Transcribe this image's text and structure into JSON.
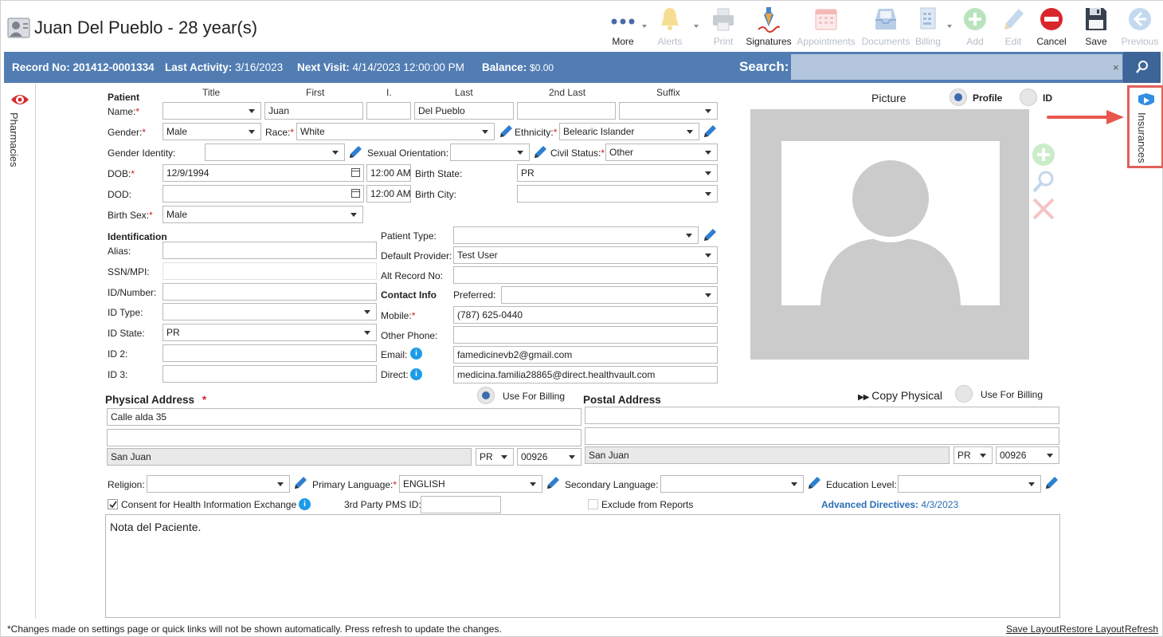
{
  "header": {
    "title": "Juan Del Pueblo - 28 year(s)"
  },
  "toolbar": [
    {
      "name": "more-button",
      "icon": "more-dots-icon",
      "label": "More",
      "enabled": true
    },
    {
      "name": "alerts-button",
      "icon": "bell-icon",
      "label": "Alerts",
      "enabled": false
    },
    {
      "name": "print-button",
      "icon": "printer-icon",
      "label": "Print",
      "enabled": false
    },
    {
      "name": "signatures-button",
      "icon": "pen-signature-icon",
      "label": "Signatures",
      "enabled": true
    },
    {
      "name": "appointments-button",
      "icon": "calendar-icon",
      "label": "Appointments",
      "enabled": false
    },
    {
      "name": "documents-button",
      "icon": "inbox-tray-icon",
      "label": "Documents",
      "enabled": false
    },
    {
      "name": "billing-button",
      "icon": "billing-icon",
      "label": "Billing",
      "enabled": false
    },
    {
      "name": "add-button",
      "icon": "plus-circle-icon",
      "label": "Add",
      "enabled": false
    },
    {
      "name": "edit-button",
      "icon": "pencil-icon",
      "label": "Edit",
      "enabled": false
    },
    {
      "name": "cancel-button",
      "icon": "cancel-circle-icon",
      "label": "Cancel",
      "enabled": true
    },
    {
      "name": "save-button",
      "icon": "floppy-disk-icon",
      "label": "Save",
      "enabled": true
    },
    {
      "name": "previous-button",
      "icon": "back-arrow-icon",
      "label": "Previous",
      "enabled": false
    }
  ],
  "bar": {
    "record_label": "Record No:",
    "record_value": "201412-0001334",
    "activity_label": "Last Activity:",
    "activity_value": "3/16/2023",
    "visit_label": "Next Visit:",
    "visit_value": "4/14/2023 12:00:00 PM",
    "balance_label": "Balance:",
    "balance_value": "$0.00",
    "search_label": "Search:",
    "search_value": "",
    "clear": "×"
  },
  "side": {
    "left_tab": "Pharmacies",
    "right_tab": "Insurances"
  },
  "patient": {
    "section": "Patient",
    "col_title": "Title",
    "col_first": "First",
    "col_initial": "I.",
    "col_last": "Last",
    "col_2ndlast": "2nd Last",
    "col_suffix": "Suffix",
    "name_label": "Name:",
    "title": "",
    "first": "Juan",
    "initial": "",
    "last": "Del Pueblo",
    "second_last": "",
    "suffix": "",
    "gender_label": "Gender:",
    "gender": "Male",
    "race_label": "Race:",
    "race": "White",
    "ethnicity_label": "Ethnicity:",
    "ethnicity": "Belearic Islander",
    "gender_identity_label": "Gender Identity:",
    "gender_identity": "",
    "sexual_orientation_label": "Sexual Orientation:",
    "sexual_orientation": "",
    "civil_status_label": "Civil Status:",
    "civil_status": "Other",
    "dob_label": "DOB:",
    "dob": "12/9/1994",
    "dob_time": "12:00 AM",
    "birth_state_label": "Birth State:",
    "birth_state": "PR",
    "dod_label": "DOD:",
    "dod": "",
    "dod_time": "12:00 AM",
    "birth_city_label": "Birth City:",
    "birth_city": "",
    "birth_sex_label": "Birth Sex:",
    "birth_sex": "Male"
  },
  "identification": {
    "section": "Identification",
    "alias_label": "Alias:",
    "alias": "",
    "ssn_label": "SSN/MPI:",
    "ssn": "",
    "idnum_label": "ID/Number:",
    "idnum": "",
    "idtype_label": "ID Type:",
    "idtype": "",
    "idstate_label": "ID State:",
    "idstate": "PR",
    "id2_label": "ID 2:",
    "id2": "",
    "id3_label": "ID 3:",
    "id3": ""
  },
  "details": {
    "patient_type_label": "Patient Type:",
    "patient_type": "",
    "default_provider_label": "Default Provider:",
    "default_provider": "Test User",
    "alt_record_label": "Alt Record No:",
    "alt_record": ""
  },
  "contact": {
    "section": "Contact Info",
    "preferred_label": "Preferred:",
    "preferred": "",
    "mobile_label": "Mobile:",
    "mobile": "(787) 625-0440",
    "other_phone_label": "Other Phone:",
    "other_phone": "",
    "email_label": "Email:",
    "email": "famedicinevb2@gmail.com",
    "direct_label": "Direct:",
    "direct": "medicina.familia28865@direct.healthvault.com"
  },
  "picture": {
    "label": "Picture",
    "profile_label": "Profile",
    "id_label": "ID"
  },
  "physical": {
    "section": "Physical Address",
    "use_billing": "Use For Billing",
    "line1": "Calle alda 35",
    "line2": "",
    "city": "San Juan",
    "state": "PR",
    "zip": "00926"
  },
  "postal": {
    "section": "Postal Address",
    "copy_label": "Copy Physical",
    "use_billing": "Use For Billing",
    "line1": "",
    "line2": "",
    "city": "San Juan",
    "state": "PR",
    "zip": "00926"
  },
  "misc": {
    "religion_label": "Religion:",
    "religion": "",
    "primary_lang_label": "Primary Language:",
    "primary_lang": "ENGLISH",
    "secondary_lang_label": "Secondary Language:",
    "secondary_lang": "",
    "education_label": "Education Level:",
    "education": "",
    "consent_label": "Consent for Health Information Exchange",
    "consent_checked": true,
    "pms_label": "3rd Party PMS ID:",
    "pms": "",
    "exclude_label": "Exclude from Reports",
    "exclude_checked": false,
    "adv_label": "Advanced Directives:",
    "adv_value": "4/3/2023"
  },
  "notes": "Nota del Paciente.",
  "footer": {
    "note": "*Changes made on settings page or quick links will not be shown automatically. Press refresh to update the changes.",
    "save_layout": "Save Layout",
    "restore_layout": "Restore Layout",
    "refresh": "Refresh"
  },
  "colors": {
    "bar": "#517db3",
    "required": "#d02020",
    "highlight": "#e0605a",
    "link": "#2b6db5"
  }
}
